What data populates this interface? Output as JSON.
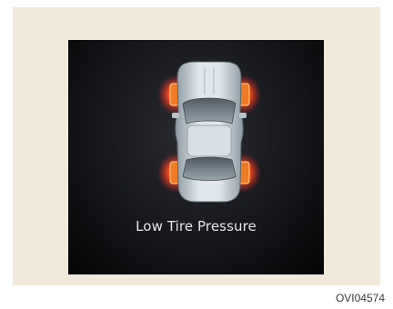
{
  "display": {
    "warning_message": "Low Tire Pressure",
    "tire_status": {
      "front_left": "low",
      "front_right": "low",
      "rear_left": "low",
      "rear_right": "low"
    },
    "warning_color": "#e8461e",
    "car_color": "#c7d3db"
  },
  "figure_code": "OVI04574"
}
